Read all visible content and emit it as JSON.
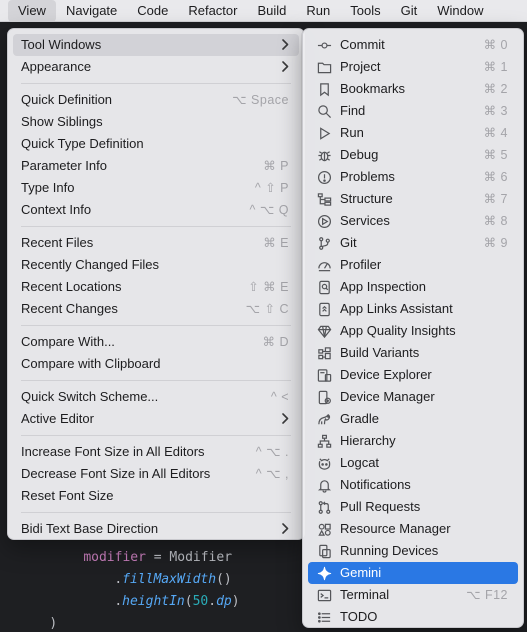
{
  "menubar": {
    "items": [
      "View",
      "Navigate",
      "Code",
      "Refactor",
      "Build",
      "Run",
      "Tools",
      "Git",
      "Window"
    ],
    "active": "View"
  },
  "editor": {
    "lines": [
      {
        "prop": "modifier",
        "eq": " = ",
        "rest": "Modifier"
      },
      {
        "dot": ".",
        "fn": "fillMaxWidth",
        "rest": "()"
      },
      {
        "dot": ".",
        "fn": "heightIn",
        "open": "(",
        "num": "50",
        "dot2": ".",
        "unit": "dp",
        "close": ")"
      },
      {
        "text": ")"
      }
    ]
  },
  "view_menu": {
    "groups": [
      [
        {
          "label": "Tool Windows",
          "submenu": true
        },
        {
          "label": "Appearance",
          "submenu": true
        }
      ],
      [
        {
          "label": "Quick Definition",
          "shortcut": "⌥ Space"
        },
        {
          "label": "Show Siblings",
          "shortcut": ""
        },
        {
          "label": "Quick Type Definition",
          "shortcut": ""
        },
        {
          "label": "Parameter Info",
          "shortcut": "⌘ P"
        },
        {
          "label": "Type Info",
          "shortcut": "^ ⇧ P"
        },
        {
          "label": "Context Info",
          "shortcut": "^ ⌥ Q"
        }
      ],
      [
        {
          "label": "Recent Files",
          "shortcut": "⌘ E"
        },
        {
          "label": "Recently Changed Files",
          "shortcut": ""
        },
        {
          "label": "Recent Locations",
          "shortcut": "⇧ ⌘ E"
        },
        {
          "label": "Recent Changes",
          "shortcut": "⌥ ⇧ C"
        }
      ],
      [
        {
          "label": "Compare With...",
          "shortcut": "⌘ D"
        },
        {
          "label": "Compare with Clipboard",
          "shortcut": ""
        }
      ],
      [
        {
          "label": "Quick Switch Scheme...",
          "shortcut": "^ <"
        },
        {
          "label": "Active Editor",
          "submenu": true
        }
      ],
      [
        {
          "label": "Increase Font Size in All Editors",
          "shortcut": "^ ⌥ ."
        },
        {
          "label": "Decrease Font Size in All Editors",
          "shortcut": "^ ⌥ ,"
        },
        {
          "label": "Reset Font Size",
          "shortcut": ""
        }
      ],
      [
        {
          "label": "Bidi Text Base Direction",
          "submenu": true
        }
      ]
    ]
  },
  "tool_windows_menu": {
    "items": [
      {
        "label": "Commit",
        "shortcut": "⌘ 0",
        "icon": "commit-icon"
      },
      {
        "label": "Project",
        "shortcut": "⌘ 1",
        "icon": "folder-icon"
      },
      {
        "label": "Bookmarks",
        "shortcut": "⌘ 2",
        "icon": "bookmark-icon"
      },
      {
        "label": "Find",
        "shortcut": "⌘ 3",
        "icon": "search-icon"
      },
      {
        "label": "Run",
        "shortcut": "⌘ 4",
        "icon": "play-icon"
      },
      {
        "label": "Debug",
        "shortcut": "⌘ 5",
        "icon": "bug-icon"
      },
      {
        "label": "Problems",
        "shortcut": "⌘ 6",
        "icon": "warning-circle-icon"
      },
      {
        "label": "Structure",
        "shortcut": "⌘ 7",
        "icon": "structure-icon"
      },
      {
        "label": "Services",
        "shortcut": "⌘ 8",
        "icon": "services-icon"
      },
      {
        "label": "Git",
        "shortcut": "⌘ 9",
        "icon": "git-branch-icon"
      },
      {
        "label": "Profiler",
        "shortcut": "",
        "icon": "gauge-icon"
      },
      {
        "label": "App Inspection",
        "shortcut": "",
        "icon": "inspection-icon"
      },
      {
        "label": "App Links Assistant",
        "shortcut": "",
        "icon": "link-icon"
      },
      {
        "label": "App Quality Insights",
        "shortcut": "",
        "icon": "diamond-icon"
      },
      {
        "label": "Build Variants",
        "shortcut": "",
        "icon": "build-variants-icon"
      },
      {
        "label": "Device Explorer",
        "shortcut": "",
        "icon": "device-explorer-icon"
      },
      {
        "label": "Device Manager",
        "shortcut": "",
        "icon": "device-manager-icon"
      },
      {
        "label": "Gradle",
        "shortcut": "",
        "icon": "gradle-icon"
      },
      {
        "label": "Hierarchy",
        "shortcut": "",
        "icon": "hierarchy-icon"
      },
      {
        "label": "Logcat",
        "shortcut": "",
        "icon": "logcat-icon"
      },
      {
        "label": "Notifications",
        "shortcut": "",
        "icon": "bell-icon"
      },
      {
        "label": "Pull Requests",
        "shortcut": "",
        "icon": "pull-request-icon"
      },
      {
        "label": "Resource Manager",
        "shortcut": "",
        "icon": "resource-manager-icon"
      },
      {
        "label": "Running Devices",
        "shortcut": "",
        "icon": "running-devices-icon"
      },
      {
        "label": "Gemini",
        "shortcut": "",
        "icon": "sparkle-icon",
        "selected": true
      },
      {
        "label": "Terminal",
        "shortcut": "⌥ F12",
        "icon": "terminal-icon"
      },
      {
        "label": "TODO",
        "shortcut": "",
        "icon": "list-icon"
      }
    ]
  },
  "colors": {
    "selection": "#2a78e4",
    "menu_bg": "#ececef",
    "editor_bg": "#1e1f22"
  }
}
